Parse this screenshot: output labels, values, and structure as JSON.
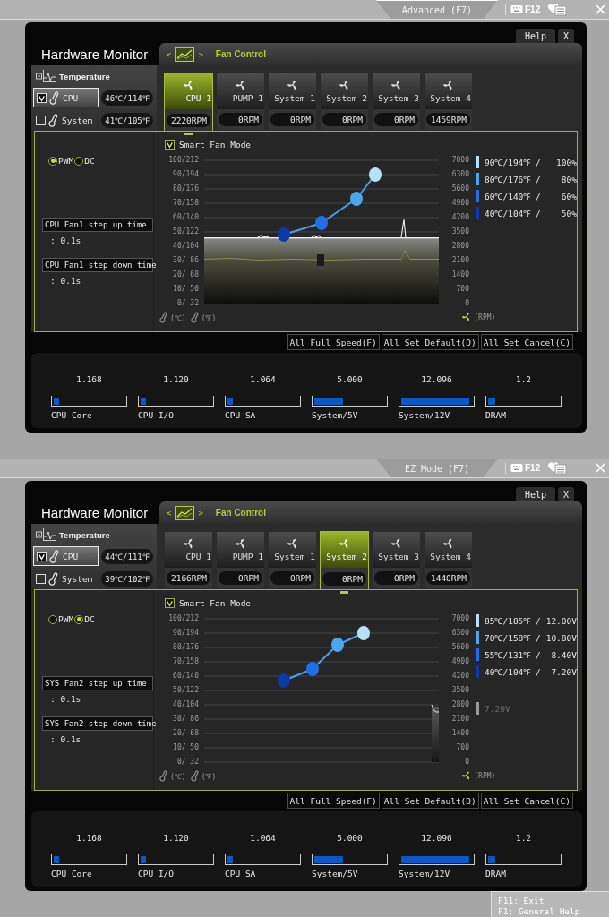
{
  "screens": [
    {
      "mode_tab": "Advanced (F7)",
      "hotkey": "F12",
      "title": "Hardware Monitor",
      "help_button": "Help",
      "close_button": "X",
      "section_tab": {
        "prev": "<",
        "label": "Fan Control",
        "next": ">"
      },
      "temperature": {
        "title": "Temperature",
        "sensors": [
          {
            "name": "CPU",
            "reading": "46℃/114℉",
            "checked": true,
            "selected": true
          },
          {
            "name": "System",
            "reading": "41℃/105℉",
            "checked": false,
            "selected": false
          }
        ]
      },
      "fans": [
        {
          "name": "CPU 1",
          "rpm": "2220RPM",
          "selected": true
        },
        {
          "name": "PUMP 1",
          "rpm": "0RPM",
          "selected": false
        },
        {
          "name": "System 1",
          "rpm": "0RPM",
          "selected": false
        },
        {
          "name": "System 2",
          "rpm": "0RPM",
          "selected": false
        },
        {
          "name": "System 3",
          "rpm": "0RPM",
          "selected": false
        },
        {
          "name": "System 4",
          "rpm": "1459RPM",
          "selected": false
        }
      ],
      "modes": [
        {
          "label": "PWM",
          "selected": true
        },
        {
          "label": "DC",
          "selected": false
        }
      ],
      "step_up": {
        "label": "CPU Fan1 step up time",
        "value": ": 0.1s"
      },
      "step_down": {
        "label": "CPU Fan1 step down time",
        "value": ": 0.1s"
      },
      "smart_fan": {
        "label": "Smart Fan Mode",
        "checked": true
      },
      "chart": {
        "left_ticks": [
          "100/212",
          "90/194",
          "80/176",
          "70/158",
          "60/140",
          "50/122",
          "40/104",
          "30/ 86",
          "20/ 68",
          "10/ 50",
          "0/ 32"
        ],
        "right_ticks": [
          "7000",
          "6300",
          "5600",
          "4900",
          "4200",
          "3500",
          "2800",
          "2100",
          "1400",
          "700",
          "0"
        ],
        "unit_c": "(℃)",
        "unit_f": "(℉)",
        "unit_rpm": "(RPM)",
        "legend": [
          {
            "kind": "point",
            "point": "90℃/194℉ /",
            "setting": "100%",
            "color": "#b4e2fa"
          },
          {
            "kind": "point",
            "point": "80℃/176℉ /",
            "setting": "80%",
            "color": "#4aa6ef"
          },
          {
            "kind": "point",
            "point": "60℃/140℉ /",
            "setting": "60%",
            "color": "#1f6fe6"
          },
          {
            "kind": "point",
            "point": "40℃/104℉ /",
            "setting": "50%",
            "color": "#0a3aa8"
          }
        ]
      },
      "actions": [
        "All Full Speed(F)",
        "All Set Default(D)",
        "All Set Cancel(C)"
      ],
      "voltages": [
        {
          "value": "1.168",
          "label": "CPU Core",
          "level": 0.08
        },
        {
          "value": "1.120",
          "label": "CPU I/O",
          "level": 0.08
        },
        {
          "value": "1.064",
          "label": "CPU SA",
          "level": 0.08
        },
        {
          "value": "5.000",
          "label": "System/5V",
          "level": 0.4
        },
        {
          "value": "12.096",
          "label": "System/12V",
          "level": 0.96
        },
        {
          "value": "1.2",
          "label": "DRAM",
          "level": 0.1
        }
      ]
    },
    {
      "mode_tab": "EZ Mode (F7)",
      "hotkey": "F12",
      "title": "Hardware Monitor",
      "help_button": "Help",
      "close_button": "X",
      "section_tab": {
        "prev": "<",
        "label": "Fan Control",
        "next": ">"
      },
      "temperature": {
        "title": "Temperature",
        "sensors": [
          {
            "name": "CPU",
            "reading": "44℃/111℉",
            "checked": true,
            "selected": true
          },
          {
            "name": "System",
            "reading": "39℃/102℉",
            "checked": false,
            "selected": false
          }
        ]
      },
      "fans": [
        {
          "name": "CPU 1",
          "rpm": "2166RPM",
          "selected": false
        },
        {
          "name": "PUMP 1",
          "rpm": "0RPM",
          "selected": false
        },
        {
          "name": "System 1",
          "rpm": "0RPM",
          "selected": false
        },
        {
          "name": "System 2",
          "rpm": "0RPM",
          "selected": true
        },
        {
          "name": "System 3",
          "rpm": "0RPM",
          "selected": false
        },
        {
          "name": "System 4",
          "rpm": "1440RPM",
          "selected": false
        }
      ],
      "modes": [
        {
          "label": "PWM",
          "selected": false
        },
        {
          "label": "DC",
          "selected": true
        }
      ],
      "step_up": {
        "label": "SYS Fan2 step up time",
        "value": ": 0.1s"
      },
      "step_down": {
        "label": "SYS Fan2 step down time",
        "value": ": 0.1s"
      },
      "smart_fan": {
        "label": "Smart Fan Mode",
        "checked": true
      },
      "chart": {
        "left_ticks": [
          "100/212",
          "90/194",
          "80/176",
          "70/158",
          "60/140",
          "50/122",
          "40/104",
          "30/ 86",
          "20/ 68",
          "10/ 50",
          "0/ 32"
        ],
        "right_ticks": [
          "7000",
          "6300",
          "5600",
          "4900",
          "4200",
          "3500",
          "2800",
          "2100",
          "1400",
          "700",
          "0"
        ],
        "unit_c": "(℃)",
        "unit_f": "(℉)",
        "unit_rpm": "(RPM)",
        "legend": [
          {
            "kind": "point",
            "point": "85℃/185℉ /",
            "setting": "12.00V",
            "color": "#b4e2fa"
          },
          {
            "kind": "point",
            "point": "70℃/158℉ /",
            "setting": "10.80V",
            "color": "#4aa6ef"
          },
          {
            "kind": "point",
            "point": "55℃/131℉ /",
            "setting": "8.40V",
            "color": "#1f6fe6"
          },
          {
            "kind": "point",
            "point": "40℃/104℉ /",
            "setting": "7.20V",
            "color": "#0a3aa8"
          },
          {
            "kind": "current",
            "setting": "7.20V",
            "color": "#9a9a9a"
          }
        ]
      },
      "actions": [
        "All Full Speed(F)",
        "All Set Default(D)",
        "All Set Cancel(C)"
      ],
      "voltages": [
        {
          "value": "1.168",
          "label": "CPU Core",
          "level": 0.08
        },
        {
          "value": "1.120",
          "label": "CPU I/O",
          "level": 0.08
        },
        {
          "value": "1.064",
          "label": "CPU SA",
          "level": 0.08
        },
        {
          "value": "5.000",
          "label": "System/5V",
          "level": 0.4
        },
        {
          "value": "12.096",
          "label": "System/12V",
          "level": 0.96
        },
        {
          "value": "1.2",
          "label": "DRAM",
          "level": 0.1
        }
      ]
    }
  ],
  "footer": [
    "F11: Exit",
    "F1: General Help"
  ]
}
